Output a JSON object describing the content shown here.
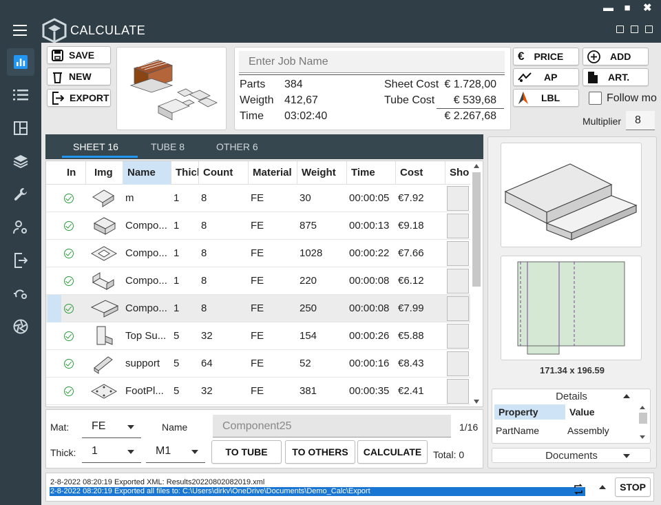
{
  "window": {
    "minimize": "▬",
    "maximize": "■",
    "close": "✖"
  },
  "app": {
    "title": "CALCULATE"
  },
  "toolbar": {
    "save": "SAVE",
    "new": "NEW",
    "export": "EXPORT"
  },
  "job": {
    "placeholder": "Enter Job Name",
    "parts_label": "Parts",
    "parts_value": "384",
    "weight_label": "Weigth",
    "weight_value": "412,67",
    "time_label": "Time",
    "time_value": "03:02:40",
    "sheet_cost_label": "Sheet Cost",
    "sheet_cost_value": "€ 1.728,00",
    "tube_cost_label": "Tube Cost",
    "tube_cost_value": "€ 539,68",
    "total_value": "€ 2.267,68"
  },
  "actions": {
    "price": "PRICE",
    "add": "ADD",
    "ap": "AP",
    "art": "ART.",
    "lbl": "LBL",
    "follow": "Follow mo",
    "multiplier_label": "Multiplier",
    "multiplier_value": "8"
  },
  "tabs": [
    "SHEET 16",
    "TUBE 8",
    "OTHER 6"
  ],
  "table": {
    "headers": [
      "In",
      "Img",
      "Name",
      "Thicl",
      "Count",
      "Material",
      "Weight",
      "Time",
      "Cost",
      "Sho"
    ],
    "rows": [
      {
        "name": "m",
        "thick": "1",
        "count": "8",
        "material": "FE",
        "weight": "30",
        "time": "00:00:05",
        "cost": "€7.92"
      },
      {
        "name": "Compo...",
        "thick": "1",
        "count": "8",
        "material": "FE",
        "weight": "875",
        "time": "00:00:13",
        "cost": "€9.18"
      },
      {
        "name": "Compo...",
        "thick": "1",
        "count": "8",
        "material": "FE",
        "weight": "1028",
        "time": "00:00:22",
        "cost": "€7.66"
      },
      {
        "name": "Compo...",
        "thick": "1",
        "count": "8",
        "material": "FE",
        "weight": "220",
        "time": "00:00:08",
        "cost": "€6.12"
      },
      {
        "name": "Compo...",
        "thick": "1",
        "count": "8",
        "material": "FE",
        "weight": "250",
        "time": "00:00:08",
        "cost": "€7.99"
      },
      {
        "name": "Top Su...",
        "thick": "5",
        "count": "32",
        "material": "FE",
        "weight": "154",
        "time": "00:00:26",
        "cost": "€5.88"
      },
      {
        "name": "support",
        "thick": "5",
        "count": "64",
        "material": "FE",
        "weight": "52",
        "time": "00:00:16",
        "cost": "€8.43"
      },
      {
        "name": "FootPl...",
        "thick": "5",
        "count": "32",
        "material": "FE",
        "weight": "381",
        "time": "00:00:35",
        "cost": "€2.41"
      }
    ]
  },
  "editor": {
    "mat_label": "Mat:",
    "mat_value": "FE",
    "thick_label": "Thick:",
    "thick_value": "1",
    "name_label": "Name",
    "name_value": "Component25",
    "m_value": "M1",
    "page": "1/16",
    "to_tube": "TO TUBE",
    "to_others": "TO OTHERS",
    "calculate": "CALCULATE",
    "total": "Total: 0"
  },
  "preview": {
    "dimensions": "171.34 x 196.59"
  },
  "details": {
    "title": "Details",
    "prop_header": "Property",
    "value_header": "Value",
    "prop": "PartName",
    "value": "Assembly"
  },
  "documents": {
    "title": "Documents"
  },
  "log": {
    "line1": "2-8-2022 08:20:19  Exported XML: Results20220802082019.xml",
    "line2": "2-8-2022 08:20:19  Exported all files to: C:\\Users\\dirkv\\OneDrive\\Documents\\Demo_Calc\\Export",
    "stop": "STOP"
  },
  "colors": {
    "titlebar": "#2f3e47",
    "accent": "#2196f3",
    "check": "#2e9b3c",
    "selected_header": "#cfe3f7"
  }
}
